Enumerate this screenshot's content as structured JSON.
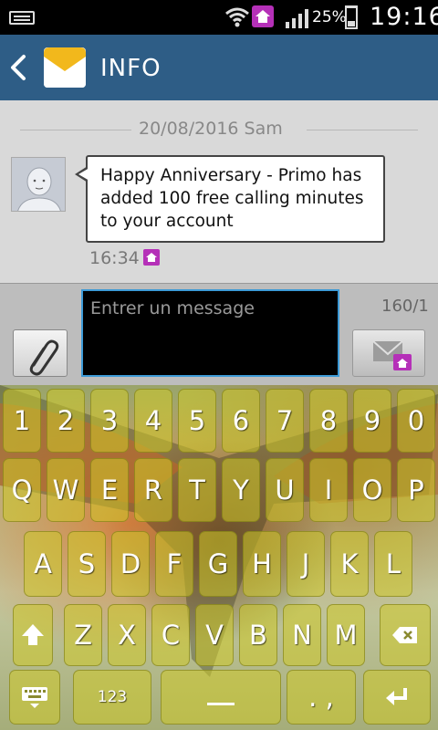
{
  "status_bar": {
    "battery_percent": "25%",
    "time": "19:16"
  },
  "action_bar": {
    "title": "INFO",
    "back_icon": "chevron-left-icon",
    "app_icon": "envelope-icon"
  },
  "conversation": {
    "date_header": "20/08/2016 Sam",
    "message": {
      "text": "Happy Anniversary - Primo has added 100 free calling minutes to your account",
      "time": "16:34"
    }
  },
  "compose": {
    "placeholder": "Entrer un message",
    "counter": "160/1"
  },
  "keyboard": {
    "number_row": [
      "1",
      "2",
      "3",
      "4",
      "5",
      "6",
      "7",
      "8",
      "9",
      "0"
    ],
    "row1": [
      "Q",
      "W",
      "E",
      "R",
      "T",
      "Y",
      "U",
      "I",
      "O",
      "P"
    ],
    "row2": [
      "A",
      "S",
      "D",
      "F",
      "G",
      "H",
      "J",
      "K",
      "L"
    ],
    "row3": [
      "Z",
      "X",
      "C",
      "V",
      "B",
      "N",
      "M"
    ],
    "symbols_key": "123",
    "punct_key": ". ,"
  },
  "colors": {
    "action_bar": "#2e5d86",
    "accent": "#b530b8",
    "input_border": "#3d9ad6"
  }
}
